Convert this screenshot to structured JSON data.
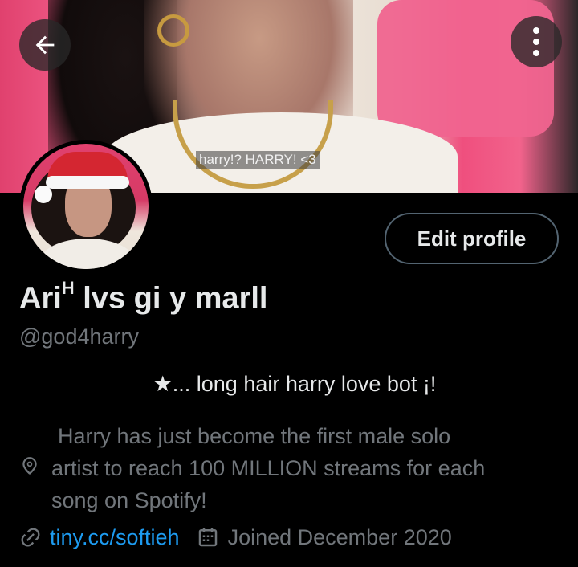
{
  "banner": {
    "caption": "harry!? HARRY! <3"
  },
  "nav": {
    "back_icon": "arrow-left-icon",
    "more_icon": "more-vertical-icon"
  },
  "profile": {
    "edit_button": "Edit profile",
    "display_name": "Ari",
    "display_name_superscript": "H",
    "display_name_rest": " lvs gi y marll",
    "handle": "@god4harry",
    "bio": "★... long hair harry love bot ¡!",
    "location_lines": [
      "Harry has just become the first male solo",
      "artist to reach 100 MILLION streams for each",
      "song on Spotify!"
    ],
    "link": "tiny.cc/softieh",
    "joined": "Joined December 2020"
  },
  "colors": {
    "background": "#000000",
    "text_primary": "#e7e9ea",
    "text_secondary": "#71767b",
    "link": "#1d9bf0",
    "button_border": "#536471"
  }
}
